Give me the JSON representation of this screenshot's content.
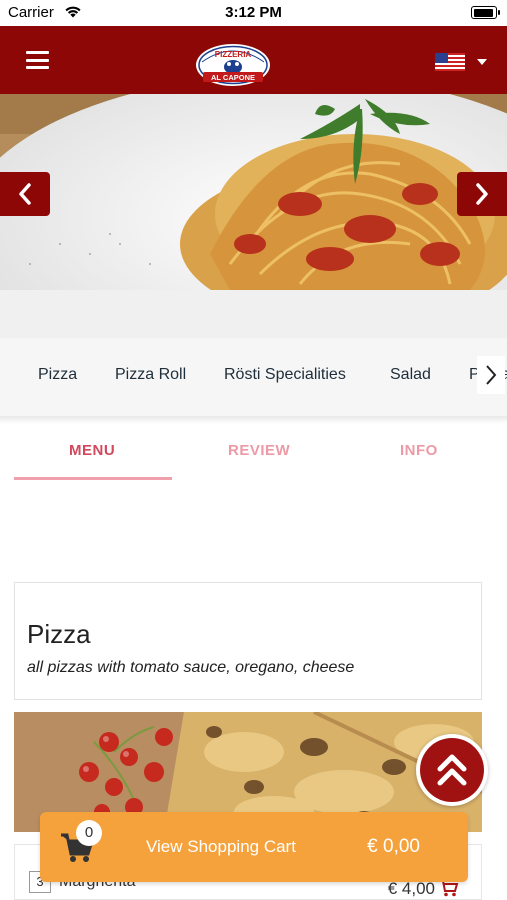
{
  "status_bar": {
    "carrier": "Carrier",
    "time": "3:12 PM",
    "wifi_icon": "wifi-icon",
    "battery_icon": "battery-icon"
  },
  "header": {
    "background": "#8e0707",
    "menu_icon": "hamburger-menu-icon",
    "logo": {
      "line1": "PIZZERIA",
      "line2": "AL CAPONE"
    },
    "language": {
      "flag_icon": "us-flag-icon",
      "dropdown_icon": "caret-down-icon"
    }
  },
  "hero": {
    "prev_icon": "chevron-left-icon",
    "next_icon": "chevron-right-icon"
  },
  "categories": {
    "items": [
      "Pizza",
      "Pizza Roll",
      "Rösti Specialities",
      "Salad",
      "Pasta"
    ],
    "scroll_icon": "chevron-right-icon"
  },
  "tabs": {
    "items": [
      {
        "label": "MENU",
        "active": true
      },
      {
        "label": "REVIEW",
        "active": false
      },
      {
        "label": "INFO",
        "active": false
      }
    ],
    "active_color": "#d2485c"
  },
  "section": {
    "title": "Pizza",
    "description": "all pizzas with tomato sauce, oregano, cheese"
  },
  "menu_items": [
    {
      "quantity": "3",
      "name": "Margherita",
      "info_icon": "info-icon",
      "veg_icon": "leaf-icon",
      "price": "€ 4,00",
      "cart_icon": "cart-icon"
    }
  ],
  "scroll_top": {
    "icon": "double-chevron-up-icon",
    "color": "#a01212"
  },
  "cart_bar": {
    "count": "0",
    "label": "View Shopping Cart",
    "total": "€ 0,00",
    "icon": "shopping-cart-icon",
    "color": "#f6a23c"
  }
}
